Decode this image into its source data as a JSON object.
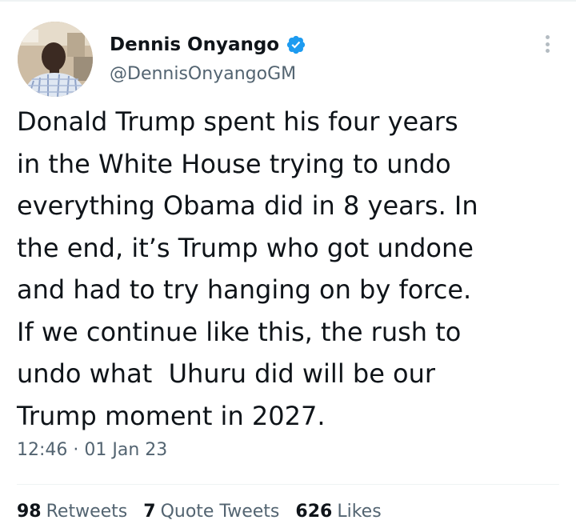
{
  "tweet": {
    "author": {
      "display_name": "Dennis Onyango",
      "handle": "@DennisOnyangoGM",
      "verified": true,
      "avatar_icon": "profile-photo"
    },
    "text_lines": [
      "Donald Trump spent his four years",
      "in the White House trying to undo",
      "everything Obama did in 8 years. In",
      "the end, it’s Trump who got undone",
      "and had to try hanging on by force.",
      "If we continue like this, the rush to",
      "undo what  Uhuru did will be our",
      "Trump moment in 2027."
    ],
    "timestamp": "12:46 · 01 Jan 23",
    "stats": {
      "retweets": {
        "count": "98",
        "label": "Retweets"
      },
      "quote_tweets": {
        "count": "7",
        "label": "Quote Tweets"
      },
      "likes": {
        "count": "626",
        "label": "Likes"
      }
    }
  },
  "colors": {
    "text_primary": "#0f1419",
    "text_secondary": "#536471",
    "verified_blue": "#1d9bf0",
    "divider": "#eff3f4",
    "more_dots": "#b4bcc2"
  },
  "icons": {
    "verified": "verified-badge-icon",
    "more": "more-options-icon"
  }
}
